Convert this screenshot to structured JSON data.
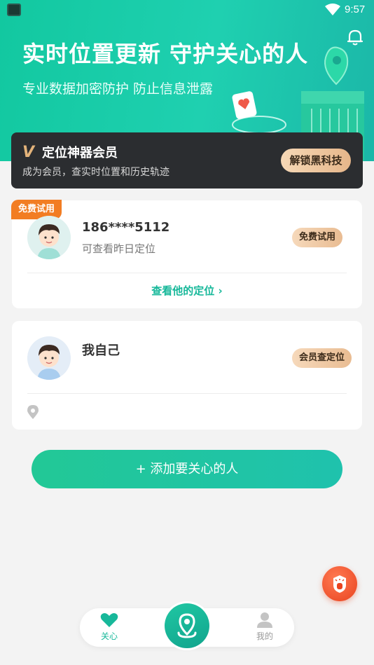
{
  "status": {
    "time": "9:57"
  },
  "banner": {
    "headline": "实时位置更新 守护关心的人",
    "subline": "专业数据加密防护 防止信息泄露"
  },
  "vip": {
    "logo": "V",
    "title": "定位神器会员",
    "subtitle": "成为会员，查实时位置和历史轨迹",
    "button": "解锁黑科技"
  },
  "contacts": [
    {
      "tag": "免费试用",
      "name": "186****5112",
      "desc": "可查看昨日定位",
      "badge": "免费试用",
      "link": "查看他的定位 ›"
    },
    {
      "name": "我自己",
      "badge": "会员查定位"
    }
  ],
  "add_button": "+ 添加要关心的人",
  "nav": {
    "care": "关心",
    "mine": "我的"
  },
  "colors": {
    "accent": "#17b89a",
    "orange": "#f27d23"
  }
}
